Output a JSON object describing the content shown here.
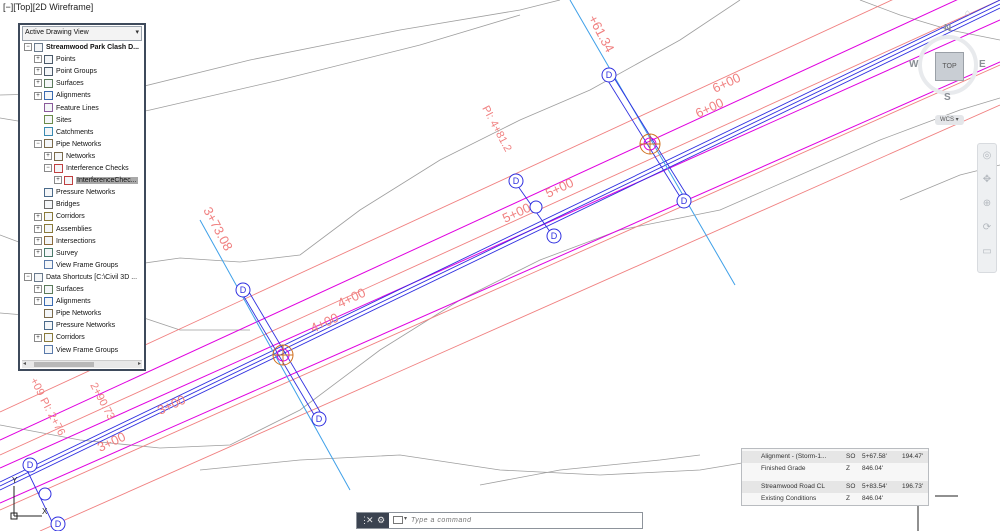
{
  "viewport": {
    "label": "[−][Top][2D Wireframe]"
  },
  "toolspace": {
    "dropdown": "Active Drawing View",
    "tree": [
      {
        "label": "Streamwood Park Clash D...",
        "bold": true,
        "exp": "−",
        "indent": 0,
        "icon": "drawing-icon"
      },
      {
        "label": "Points",
        "exp": "+",
        "indent": 1,
        "icon": "points-icon"
      },
      {
        "label": "Point Groups",
        "exp": "+",
        "indent": 1,
        "icon": "point-groups-icon"
      },
      {
        "label": "Surfaces",
        "exp": "+",
        "indent": 1,
        "icon": "surfaces-icon"
      },
      {
        "label": "Alignments",
        "exp": "+",
        "indent": 1,
        "icon": "alignments-icon"
      },
      {
        "label": "Feature Lines",
        "exp": "",
        "indent": 1,
        "icon": "feature-lines-icon"
      },
      {
        "label": "Sites",
        "exp": "",
        "indent": 1,
        "icon": "sites-icon"
      },
      {
        "label": "Catchments",
        "exp": "",
        "indent": 1,
        "icon": "catchments-icon"
      },
      {
        "label": "Pipe Networks",
        "exp": "−",
        "indent": 1,
        "icon": "pipe-networks-icon"
      },
      {
        "label": "Networks",
        "exp": "+",
        "indent": 2,
        "icon": "networks-icon"
      },
      {
        "label": "Interference Checks",
        "exp": "−",
        "indent": 2,
        "icon": "interference-checks-icon"
      },
      {
        "label": "InterferenceChec...",
        "exp": "+",
        "indent": 3,
        "icon": "interference-check-icon",
        "selected": true
      },
      {
        "label": "Pressure Networks",
        "exp": "",
        "indent": 1,
        "icon": "pressure-networks-icon"
      },
      {
        "label": "Bridges",
        "exp": "",
        "indent": 1,
        "icon": "bridges-icon"
      },
      {
        "label": "Corridors",
        "exp": "+",
        "indent": 1,
        "icon": "corridors-icon"
      },
      {
        "label": "Assemblies",
        "exp": "+",
        "indent": 1,
        "icon": "assemblies-icon"
      },
      {
        "label": "Intersections",
        "exp": "+",
        "indent": 1,
        "icon": "intersections-icon"
      },
      {
        "label": "Survey",
        "exp": "+",
        "indent": 1,
        "icon": "survey-icon"
      },
      {
        "label": "View Frame Groups",
        "exp": "",
        "indent": 1,
        "icon": "view-frame-groups-icon"
      },
      {
        "label": "Data Shortcuts [C:\\Civil 3D ...",
        "exp": "−",
        "indent": 0,
        "icon": "data-shortcuts-icon"
      },
      {
        "label": "Surfaces",
        "exp": "+",
        "indent": 1,
        "icon": "surfaces-icon"
      },
      {
        "label": "Alignments",
        "exp": "+",
        "indent": 1,
        "icon": "alignments-icon"
      },
      {
        "label": "Pipe Networks",
        "exp": "",
        "indent": 1,
        "icon": "pipe-networks-icon"
      },
      {
        "label": "Pressure Networks",
        "exp": "",
        "indent": 1,
        "icon": "pressure-networks-icon"
      },
      {
        "label": "Corridors",
        "exp": "+",
        "indent": 1,
        "icon": "corridors-icon"
      },
      {
        "label": "View Frame Groups",
        "exp": "",
        "indent": 1,
        "icon": "view-frame-groups-icon"
      }
    ]
  },
  "viewcube": {
    "north": "N",
    "south": "S",
    "east": "E",
    "west": "W",
    "top": "TOP",
    "wcs": "WCS ▾"
  },
  "drawing": {
    "stations_main": [
      "3+00",
      "4+00",
      "5+00",
      "6+00"
    ],
    "stations_sub": [
      "3+00",
      "4+00",
      "5+00",
      "6+00"
    ],
    "station_cross_1": "3+73.08",
    "station_cross_2": "+61.34",
    "pi_label": "PI: 4+81.2",
    "left_labels": [
      "2+90.73",
      "PI: 2+76",
      "+09"
    ],
    "structure_letter": "D",
    "ucs": {
      "y": "Y",
      "x": "X"
    }
  },
  "tooltip": {
    "rows": [
      {
        "name": "Alignment - (Storm-1...",
        "code": "SO",
        "station": "5+67.58'",
        "value": "194.47'"
      },
      {
        "name": "Finished Grade",
        "code": "Z",
        "station": "846.04'",
        "value": ""
      },
      {
        "name": "Streamwood Road CL",
        "code": "SO",
        "station": "5+83.54'",
        "value": "196.73'"
      },
      {
        "name": "Existing Conditions",
        "code": "Z",
        "station": "846.04'",
        "value": ""
      }
    ]
  },
  "command": {
    "placeholder": "Type a command"
  },
  "colors": {
    "magenta": "#e000e0",
    "salmon": "#f08080",
    "blue": "#3030e0",
    "cyan": "#3fa0e8",
    "gray": "#9e9e9e",
    "orange": "#d07020"
  }
}
